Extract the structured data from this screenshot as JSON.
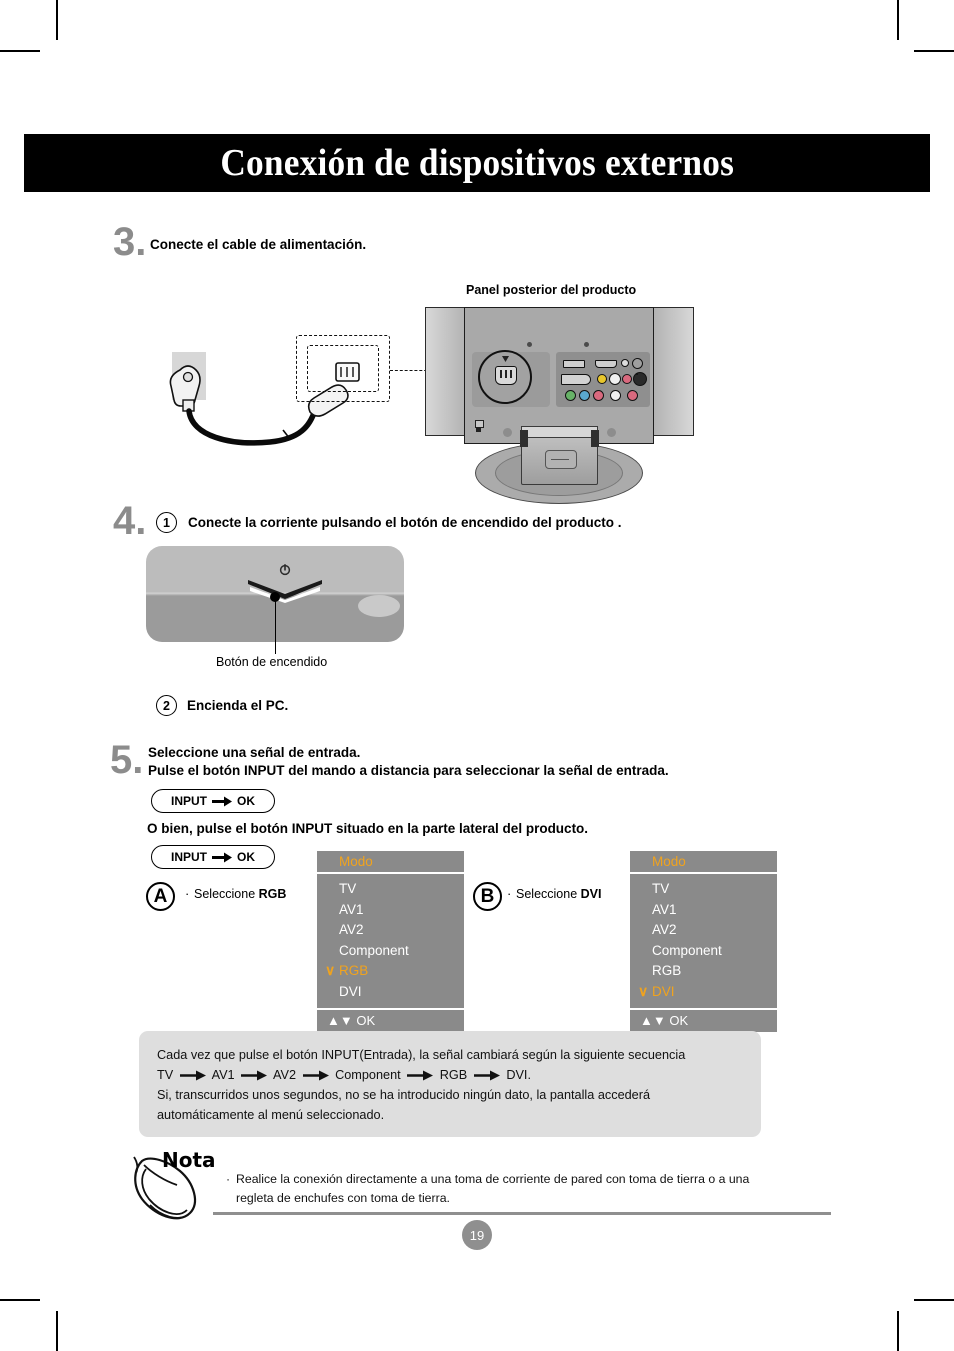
{
  "page": {
    "title": "Conexión de dispositivos externos",
    "number": "19"
  },
  "steps": [
    {
      "number": "3.",
      "heading": "Conecte el cable de alimentación.",
      "figure_caption": "Panel posterior del producto"
    },
    {
      "number": "4.",
      "items": [
        {
          "marker": "1",
          "text": "Conecte la corriente pulsando el botón de encendido del producto ."
        },
        {
          "marker": "2",
          "text": "Encienda el PC."
        }
      ],
      "power_button_caption": "Botón de encendido"
    },
    {
      "number": "5.",
      "heading_line1": "Seleccione una señal de entrada.",
      "heading_line2": "Pulse el botón INPUT del mando a distancia para seleccionar la señal de entrada.",
      "alt_line": "O bien, pulse el botón INPUT situado en la parte lateral del producto."
    }
  ],
  "pills": [
    {
      "left_label": "INPUT",
      "right_label": "OK"
    },
    {
      "left_label": "INPUT",
      "right_label": "OK"
    }
  ],
  "options": [
    {
      "marker": "A",
      "bullet": "·",
      "label_prefix": "Seleccione ",
      "label_strong": "RGB",
      "osd": {
        "title": "Modo",
        "items": [
          "TV",
          "AV1",
          "AV2",
          "Component",
          "RGB",
          "DVI"
        ],
        "selected": "RGB",
        "footer": "OK",
        "footer_icons": "▲▼"
      }
    },
    {
      "marker": "B",
      "bullet": "·",
      "label_prefix": "Seleccione ",
      "label_strong": "DVI",
      "osd": {
        "title": "Modo",
        "items": [
          "TV",
          "AV1",
          "AV2",
          "Component",
          "RGB",
          "DVI"
        ],
        "selected": "DVI",
        "footer": "OK",
        "footer_icons": "▲▼"
      }
    }
  ],
  "info_box": {
    "line1": "Cada vez que pulse el botón INPUT(Entrada), la señal cambiará según la siguiente secuencia",
    "sequence": [
      "TV",
      "AV1",
      "AV2",
      "Component",
      "RGB",
      "DVI."
    ],
    "line3": "Si, transcurridos unos segundos, no se ha introducido ningún dato, la pantalla accederá",
    "line4": "automáticamente al menú seleccionado."
  },
  "nota": {
    "label": "Nota",
    "bullet": "·",
    "line1": "Realice la conexión directamente a una toma de corriente de pared con toma de tierra o a una",
    "line2": "regleta de enchufes con toma de tierra."
  },
  "colors": {
    "accent_orange": "#f0a31e",
    "osd_background": "#8a8a8a",
    "step_number_gray": "#8c8c8c",
    "info_box_gray": "#dedede",
    "page_badge_gray": "#8f8f8f"
  }
}
